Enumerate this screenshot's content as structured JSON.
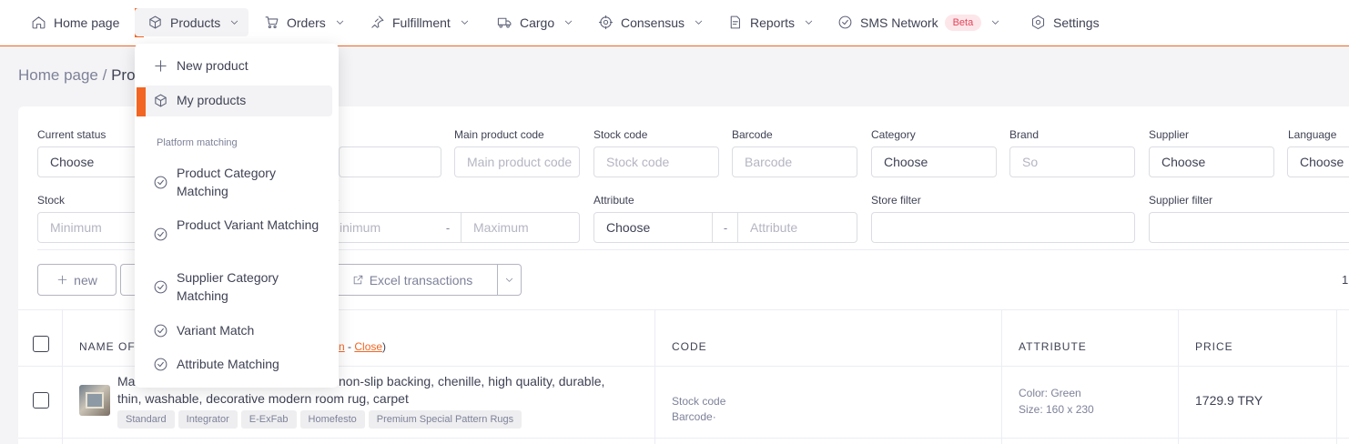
{
  "nav": {
    "home": "Home page",
    "products": "Products",
    "orders": "Orders",
    "fulfillment": "Fulfillment",
    "cargo": "Cargo",
    "consensus": "Consensus",
    "reports": "Reports",
    "sms_network": "SMS Network",
    "beta_badge": "Beta",
    "settings": "Settings"
  },
  "breadcrumb": {
    "home": "Home page /",
    "current": "Pro"
  },
  "filters": {
    "current_status": {
      "label": "Current status",
      "value": "Choose"
    },
    "main_product_code": {
      "label": "Main product code",
      "placeholder": "Main product code"
    },
    "stock_code": {
      "label": "Stock code",
      "placeholder": "Stock code"
    },
    "barcode": {
      "label": "Barcode",
      "placeholder": "Barcode"
    },
    "category": {
      "label": "Category",
      "value": "Choose"
    },
    "brand": {
      "label": "Brand",
      "placeholder": "So"
    },
    "supplier": {
      "label": "Supplier",
      "value": "Choose"
    },
    "language": {
      "label": "Language",
      "value": "Choose"
    },
    "stock": {
      "label": "Stock",
      "min_placeholder": "Minimum"
    },
    "price": {
      "label": "e",
      "min_placeholder": "inimum",
      "max_placeholder": "Maximum",
      "separator": "-"
    },
    "attribute": {
      "label": "Attribute",
      "value": "Choose",
      "placeholder": "Attribute",
      "separator": "-"
    },
    "store_filter": {
      "label": "Store filter"
    },
    "supplier_filter": {
      "label": "Supplier filter"
    }
  },
  "toolbar": {
    "new_label": "new",
    "excel_label": "Excel transactions",
    "page_indicator": "1"
  },
  "table": {
    "headers": {
      "name": "NAME OF",
      "code": "CODE",
      "attribute": "ATTRIBUTE",
      "price": "PRICE"
    },
    "header_links": {
      "open": "n",
      "sep": " - ",
      "close": "Close",
      "paren": ")"
    },
    "rows": [
      {
        "name_line1_a": "Ma",
        "name_line1_b": "non-slip backing, chenille, high quality, durable,",
        "name_line2": "thin, washable, decorative modern room rug, carpet",
        "tags": [
          "Standard",
          "Integrator",
          "E-ExFab",
          "Homefesto",
          "Premium Special Pattern Rugs"
        ],
        "code_stock": "Stock code",
        "code_barcode": "Barcode·",
        "attr_color": "Color: Green",
        "attr_size": "Size: 160 x 230",
        "price": "1729.9 TRY"
      }
    ]
  },
  "dropdown": {
    "new_product": "New product",
    "my_products": "My products",
    "section_label": "Platform matching",
    "items": [
      "Product Category Matching",
      "Product Variant Matching",
      "Supplier Category Matching",
      "Variant Match",
      "Attribute Matching"
    ]
  },
  "colors": {
    "accent": "#f26522",
    "badge_bg": "#fde6e9",
    "badge_text": "#e0465a"
  }
}
